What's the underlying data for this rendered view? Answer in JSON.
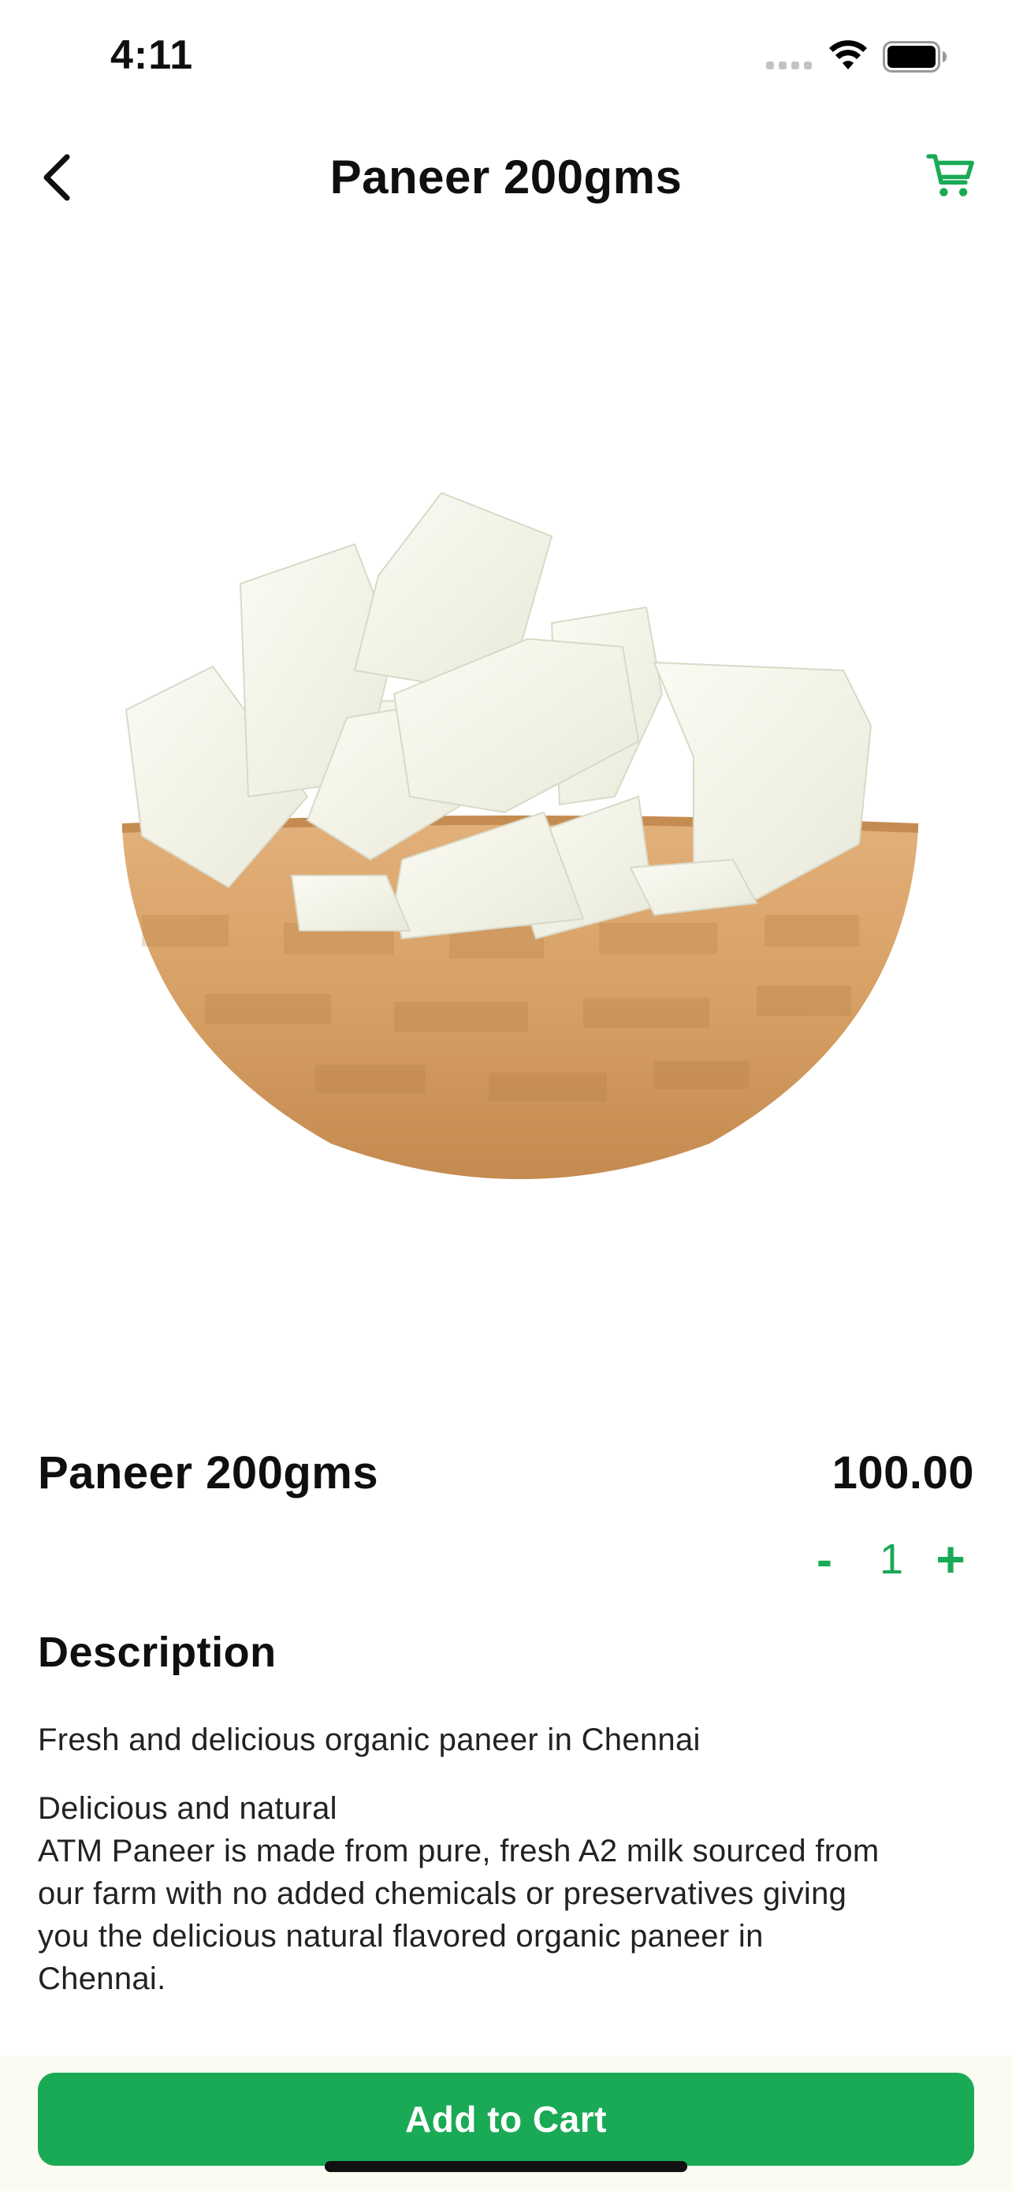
{
  "status_bar": {
    "time": "4:11"
  },
  "header": {
    "title": "Paneer 200gms",
    "back_icon": "chevron-left-icon",
    "cart_icon": "cart-icon"
  },
  "product": {
    "name": "Paneer 200gms",
    "price": "100.00",
    "image_desc": "paneer-cubes-in-wooden-bowl",
    "quantity": {
      "minus": "-",
      "value": "1",
      "plus": "+"
    }
  },
  "description": {
    "heading": "Description",
    "short": "Fresh and delicious organic paneer in Chennai",
    "long_lines": [
      "Delicious and natural",
      "ATM Paneer is made from pure, fresh A2 milk sourced from",
      "our farm with no added chemicals or preservatives giving",
      "you the delicious natural flavored organic paneer in",
      "Chennai."
    ]
  },
  "actions": {
    "add_to_cart": "Add to Cart"
  },
  "colors": {
    "accent": "#1aaa55",
    "bottom_bg": "#fbfbf2"
  }
}
